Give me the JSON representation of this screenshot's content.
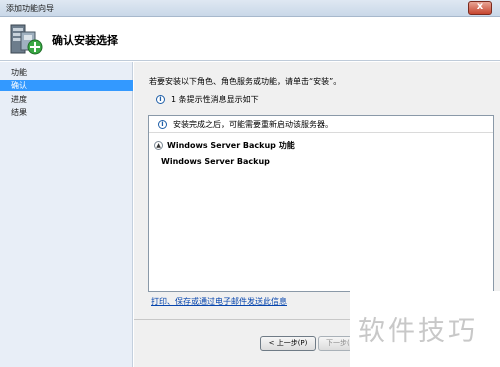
{
  "window": {
    "title": "添加功能向导",
    "close_label": "x"
  },
  "header": {
    "title": "确认安装选择",
    "icon": "server-add-icon"
  },
  "sidebar": {
    "items": [
      {
        "label": "功能",
        "active": false
      },
      {
        "label": "确认",
        "active": true
      },
      {
        "label": "进度",
        "active": false
      },
      {
        "label": "结果",
        "active": false
      }
    ]
  },
  "main": {
    "intro": "若要安装以下角色、角色服务或功能，请单击“安装”。",
    "info_message": "1 条提示性消息显示如下",
    "notice": "安装完成之后，可能需要重新启动该服务器。",
    "section_title": "Windows Server Backup 功能",
    "feature": "Windows Server Backup",
    "print_link": "打印、保存或通过电子邮件发送此信息"
  },
  "buttons": {
    "prev": "< 上一步(P)",
    "next": "下一步(N"
  },
  "watermark": "软件技巧",
  "colors": {
    "accent": "#3399ff",
    "link": "#0645ad"
  }
}
